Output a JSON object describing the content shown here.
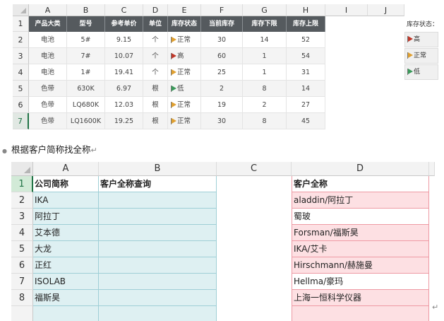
{
  "sheet1": {
    "columns": [
      "A",
      "B",
      "C",
      "D",
      "E",
      "F",
      "G",
      "H",
      "I",
      "J"
    ],
    "row_numbers": [
      "1",
      "2",
      "3",
      "4",
      "5",
      "6",
      "7"
    ],
    "headers": [
      "产品大类",
      "型号",
      "参考单价",
      "单位",
      "库存状态",
      "当前库存",
      "库存下限",
      "库存上限"
    ],
    "rows": [
      [
        "电池",
        "5#",
        "9.15",
        "个",
        "正常",
        "30",
        "14",
        "52"
      ],
      [
        "电池",
        "7#",
        "10.07",
        "个",
        "高",
        "60",
        "1",
        "54"
      ],
      [
        "电池",
        "1#",
        "19.41",
        "个",
        "正常",
        "25",
        "1",
        "31"
      ],
      [
        "色带",
        "630K",
        "6.97",
        "根",
        "低",
        "2",
        "8",
        "14"
      ],
      [
        "色带",
        "LQ680K",
        "12.03",
        "根",
        "正常",
        "19",
        "2",
        "27"
      ],
      [
        "色带",
        "LQ1600K",
        "19.25",
        "根",
        "正常",
        "30",
        "8",
        "45"
      ]
    ],
    "row_status": [
      "normal",
      "high",
      "normal",
      "low",
      "normal",
      "normal"
    ],
    "legend_title": "库存状态：",
    "legend": [
      "高",
      "正常",
      "低"
    ]
  },
  "subtitle": "根据客户简称找全称",
  "return_mark": "↵",
  "sheet2": {
    "columns": [
      "A",
      "B",
      "C",
      "D"
    ],
    "row_numbers": [
      "1",
      "2",
      "3",
      "4",
      "5",
      "6",
      "7",
      "8"
    ],
    "header_a": "公司简称",
    "header_b": "客户全称查询",
    "header_d": "客户全称",
    "col_a": [
      "IKA",
      "阿拉丁",
      "艾本德",
      "大龙",
      "正红",
      "ISOLAB",
      "福斯昊"
    ],
    "col_d": [
      "aladdin/阿拉丁",
      "蜀玻",
      "Forsman/福斯昊",
      "IKA/艾卡",
      "Hirschmann/赫施曼",
      "Hellma/豪玛",
      "上海一恒科学仪器"
    ]
  },
  "colors": {
    "header_dark": "#555a5e",
    "teal_fill": "#def0f2",
    "pink_fill": "#fde0e3",
    "flag_high": "#c0392b",
    "flag_normal": "#e0a030",
    "flag_low": "#3a9a5a"
  }
}
